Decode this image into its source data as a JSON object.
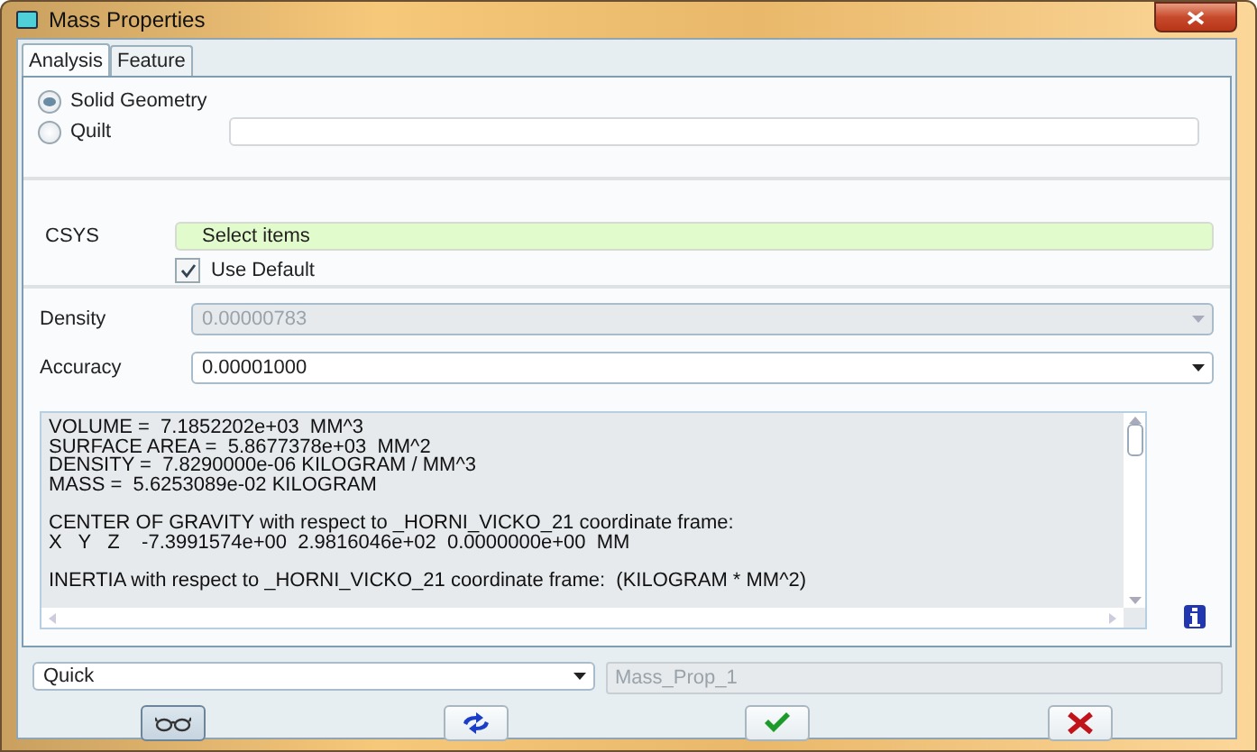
{
  "window": {
    "title": "Mass Properties"
  },
  "tabs": [
    {
      "label": "Analysis",
      "selected": true
    },
    {
      "label": "Feature",
      "selected": false
    }
  ],
  "geometry_options": [
    {
      "label": "Solid Geometry",
      "selected": true
    },
    {
      "label": "Quilt",
      "selected": false
    }
  ],
  "csys": {
    "label": "CSYS",
    "value": "Select items",
    "use_default": {
      "label": "Use Default",
      "checked": true
    }
  },
  "density": {
    "label": "Density",
    "value": "0.00000783",
    "disabled": true
  },
  "accuracy": {
    "label": "Accuracy",
    "value": "0.00001000",
    "disabled": false
  },
  "results": {
    "sections": [
      [
        "VOLUME =  7.1852202e+03  MM^3",
        "SURFACE AREA =  5.8677378e+03  MM^2",
        "DENSITY =  7.8290000e-06 KILOGRAM / MM^3",
        "MASS =  5.6253089e-02 KILOGRAM"
      ],
      [
        "CENTER OF GRAVITY with respect to _HORNI_VICKO_21 coordinate frame:",
        "X   Y   Z    -7.3991574e+00  2.9816046e+02  0.0000000e+00  MM"
      ],
      [
        "INERTIA with respect to _HORNI_VICKO_21 coordinate frame:  (KILOGRAM * MM^2)"
      ]
    ]
  },
  "mode": {
    "value": "Quick"
  },
  "name_field": {
    "value": "Mass_Prop_1",
    "disabled": true
  },
  "buttons": [
    {
      "kind": "preview",
      "selected": true
    },
    {
      "kind": "repeat",
      "selected": false
    },
    {
      "kind": "ok",
      "selected": false
    },
    {
      "kind": "cancel",
      "selected": false
    }
  ]
}
